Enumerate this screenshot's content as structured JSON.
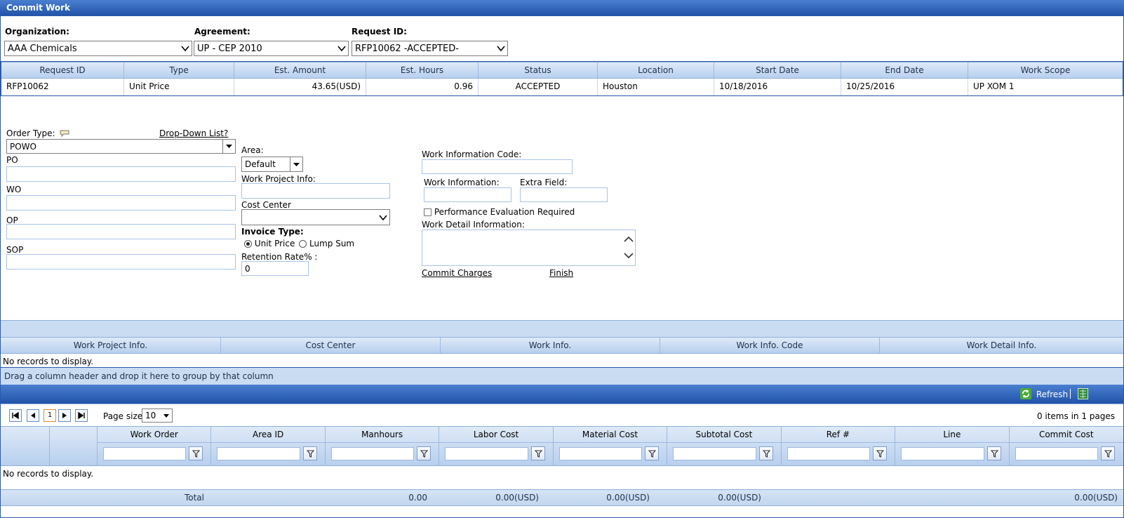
{
  "window": {
    "title": "Commit Work"
  },
  "selectors": {
    "organization": {
      "label": "Organization:",
      "value": "AAA Chemicals"
    },
    "agreement": {
      "label": "Agreement:",
      "value": "UP - CEP 2010"
    },
    "request_id": {
      "label": "Request ID:",
      "value": "RFP10062 -ACCEPTED-"
    }
  },
  "request_table": {
    "columns": [
      "Request ID",
      "Type",
      "Est. Amount",
      "Est. Hours",
      "Status",
      "Location",
      "Start Date",
      "End Date",
      "Work Scope"
    ],
    "row": [
      "RFP10062",
      "Unit Price",
      "43.65(USD)",
      "0.96",
      "ACCEPTED",
      "Houston",
      "10/18/2016",
      "10/25/2016",
      "UP XOM 1"
    ]
  },
  "form": {
    "order_type_label": "Order Type:",
    "dropdown_list_link": "Drop-Down List?",
    "order_type_value": "POWO",
    "po_label": "PO",
    "wo_label": "WO",
    "op_label": "OP",
    "sop_label": "SOP",
    "area_label": "Area:",
    "area_value": "Default",
    "work_project_info_label": "Work Project Info:",
    "cost_center_label": "Cost Center",
    "invoice_type_label": "Invoice Type:",
    "invoice_unit_price": "Unit Price",
    "invoice_lump_sum": "Lump Sum",
    "retention_label": "Retention Rate% :",
    "retention_value": "0",
    "work_info_code_label": "Work Information Code:",
    "work_info_label": "Work Information:",
    "extra_field_label": "Extra Field:",
    "perf_eval_label": "Performance Evaluation Required",
    "work_detail_label": "Work Detail Information:",
    "commit_charges_link": "Commit Charges",
    "finish_link": "Finish"
  },
  "work_info_table": {
    "columns": [
      "Work Project Info.",
      "Cost Center",
      "Work Info.",
      "Work Info. Code",
      "Work Detail Info."
    ],
    "empty_text": "No records to display."
  },
  "group_panel": {
    "text": "Drag a column header and drop it here to group by that column"
  },
  "toolbar": {
    "refresh_label": "Refresh"
  },
  "pager": {
    "current_page": "1",
    "page_size_label": "Page size:",
    "page_size_value": "10",
    "summary": "0 items in 1 pages"
  },
  "commit_table": {
    "columns": [
      "Work Order",
      "Area ID",
      "Manhours",
      "Labor Cost",
      "Material Cost",
      "Subtotal Cost",
      "Ref #",
      "Line",
      "Commit Cost"
    ],
    "empty_text": "No records to display.",
    "footer": {
      "label": "Total",
      "manhours": "0.00",
      "labor_cost": "0.00(USD)",
      "material_cost": "0.00(USD)",
      "subtotal_cost": "0.00(USD)",
      "commit_cost": "0.00(USD)"
    }
  },
  "colors": {
    "title_bar": "#2b5aa8",
    "header_light": "#c9dcf2",
    "border": "#2b5aa8"
  }
}
